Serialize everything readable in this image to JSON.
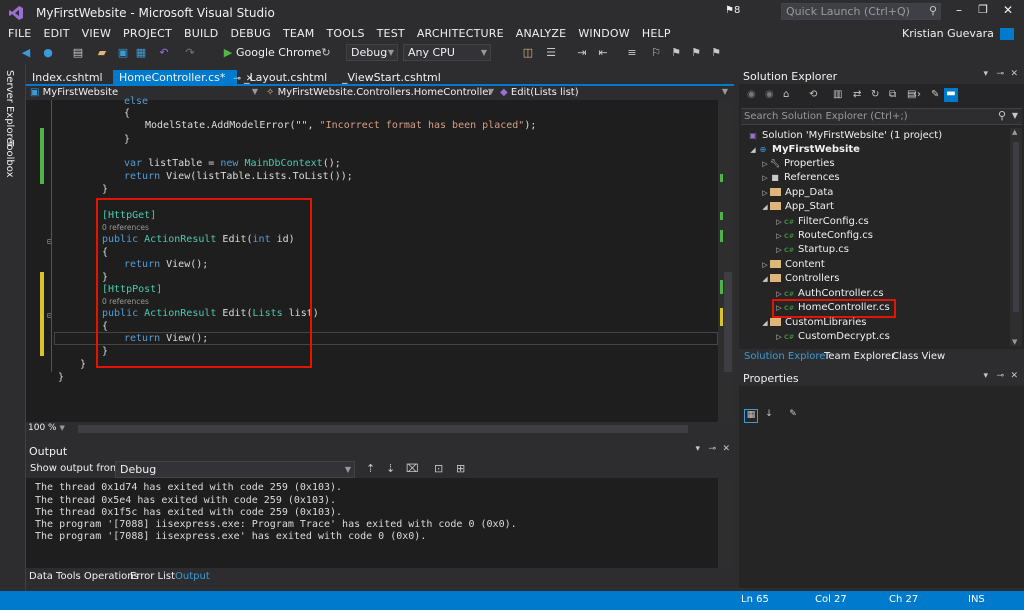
{
  "window": {
    "title": "MyFirstWebsite - Microsoft Visual Studio",
    "notif_count": "8",
    "quick_launch_placeholder": "Quick Launch (Ctrl+Q)",
    "user": "Kristian Guevara"
  },
  "menu": [
    "FILE",
    "EDIT",
    "VIEW",
    "PROJECT",
    "BUILD",
    "DEBUG",
    "TEAM",
    "TOOLS",
    "TEST",
    "ARCHITECTURE",
    "ANALYZE",
    "WINDOW",
    "HELP"
  ],
  "toolbar": {
    "browser": "Google Chrome",
    "config": "Debug",
    "platform": "Any CPU"
  },
  "side_tabs": {
    "server_explorer": "Server Explorer",
    "toolbox": "Toolbox"
  },
  "doc_tabs": [
    "Index.cshtml",
    "HomeController.cs*",
    "_Layout.cshtml",
    "_ViewStart.cshtml"
  ],
  "nav": {
    "project": "MyFirstWebsite",
    "class": "MyFirstWebsite.Controllers.HomeController",
    "member": "Edit(Lists list)"
  },
  "code": {
    "l0": "else",
    "l1": "{",
    "l2a": "ModelState.AddModelError(\"\", ",
    "l2b": "\"Incorrect format has been placed\"",
    "l2c": ");",
    "l3": "}",
    "l4a": "var",
    "l4b": " listTable = ",
    "l4c": "new",
    "l4d": "MainDbContext",
    "l4e": "();",
    "l5a": "return",
    "l5b": " View(listTable.Lists.ToList());",
    "l6": "}",
    "l7": "[HttpGet]",
    "refs1": "0 references",
    "l8a": "public",
    "l8b": "ActionResult",
    "l8c": " Edit(",
    "l8d": "int",
    "l8e": " id)",
    "l9": "{",
    "l10a": "return",
    "l10b": " View();",
    "l11": "}",
    "l12": "[HttpPost]",
    "refs2": "0 references",
    "l13a": "public",
    "l13b": "ActionResult",
    "l13c": " Edit(",
    "l13d": "Lists",
    "l13e": " list)",
    "l14": "{",
    "l15a": "return",
    "l15b": " View();",
    "l16": "}",
    "l17": "}",
    "l18": "}"
  },
  "zoom": "100 %",
  "output": {
    "title": "Output",
    "show_from_label": "Show output from:",
    "source": "Debug",
    "lines": [
      "The thread 0x1d74 has exited with code 259 (0x103).",
      "The thread 0x5e4 has exited with code 259 (0x103).",
      "The thread 0x1f5c has exited with code 259 (0x103).",
      "The program '[7088] iisexpress.exe: Program Trace' has exited with code 0 (0x0).",
      "The program '[7088] iisexpress.exe' has exited with code 0 (0x0)."
    ]
  },
  "bottom_tabs": [
    "Data Tools Operations",
    "Error List",
    "Output"
  ],
  "solution_explorer": {
    "title": "Solution Explorer",
    "search_placeholder": "Search Solution Explorer (Ctrl+;)",
    "items": [
      "Solution 'MyFirstWebsite' (1 project)",
      "MyFirstWebsite",
      "Properties",
      "References",
      "App_Data",
      "App_Start",
      "FilterConfig.cs",
      "RouteConfig.cs",
      "Startup.cs",
      "Content",
      "Controllers",
      "AuthController.cs",
      "HomeController.cs",
      "CustomLibraries",
      "CustomDecrypt.cs"
    ],
    "tabs": [
      "Solution Explorer",
      "Team Explorer",
      "Class View"
    ]
  },
  "properties": {
    "title": "Properties"
  },
  "status": {
    "ln": "Ln 65",
    "col": "Col 27",
    "ch": "Ch 27",
    "ins": "INS"
  },
  "colors": {
    "accent": "#007acc",
    "highlight": "#e51400"
  }
}
